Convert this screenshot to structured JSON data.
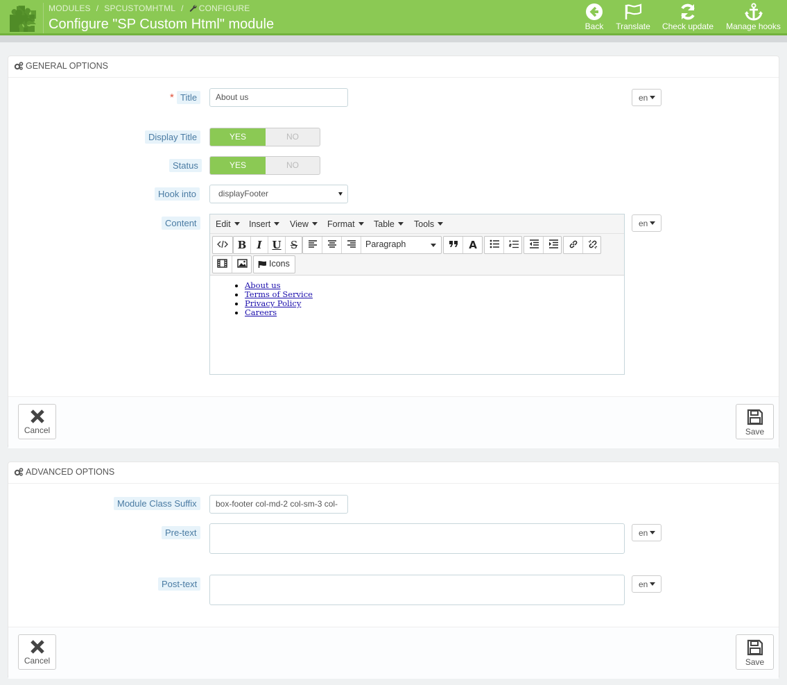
{
  "header": {
    "breadcrumb": [
      "MODULES",
      "SPCUSTOMHTML",
      "CONFIGURE"
    ],
    "title": "Configure \"SP Custom Html\" module",
    "toolbar": [
      {
        "label": "Back",
        "icon": "back-circle-icon"
      },
      {
        "label": "Translate",
        "icon": "flag-icon"
      },
      {
        "label": "Check update",
        "icon": "refresh-icon"
      },
      {
        "label": "Manage hooks",
        "icon": "anchor-icon"
      }
    ],
    "colors": {
      "bar": "#8bc954",
      "bar_border": "#72b23d"
    }
  },
  "general": {
    "heading": "GENERAL OPTIONS",
    "title_label": "Title",
    "title_value": "About us",
    "lang": "en",
    "display_title_label": "Display Title",
    "status_label": "Status",
    "yes": "YES",
    "no": "NO",
    "hook_label": "Hook into",
    "hook_value": "displayFooter",
    "content_label": "Content",
    "editor": {
      "menus": [
        "Edit",
        "Insert",
        "View",
        "Format",
        "Table",
        "Tools"
      ],
      "block_format": "Paragraph",
      "icons_label": "Icons",
      "links": [
        "About us",
        "Terms of Service",
        "Privacy Policy",
        "Careers"
      ]
    },
    "cancel": "Cancel",
    "save": "Save"
  },
  "advanced": {
    "heading": "ADVANCED OPTIONS",
    "suffix_label": "Module Class Suffix",
    "suffix_value": "box-footer col-md-2 col-sm-3 col-",
    "pretext_label": "Pre-text",
    "posttext_label": "Post-text",
    "lang": "en",
    "cancel": "Cancel",
    "save": "Save"
  }
}
